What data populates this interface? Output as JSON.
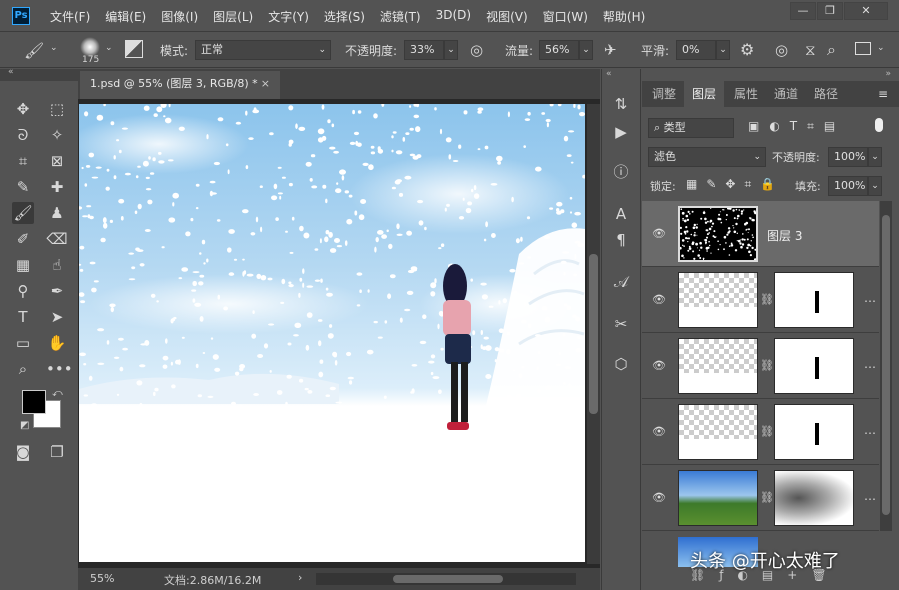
{
  "app": {
    "logo": "Ps"
  },
  "menu": [
    "文件(F)",
    "编辑(E)",
    "图像(I)",
    "图层(L)",
    "文字(Y)",
    "选择(S)",
    "滤镜(T)",
    "3D(D)",
    "视图(V)",
    "窗口(W)",
    "帮助(H)"
  ],
  "window_controls": {
    "minimize": "—",
    "restore": "❐",
    "close": "✕"
  },
  "options": {
    "brush_size": "175",
    "mode_label": "模式:",
    "mode_value": "正常",
    "opacity_label": "不透明度:",
    "opacity_value": "33%",
    "flow_label": "流量:",
    "flow_value": "56%",
    "smooth_label": "平滑:",
    "smooth_value": "0%"
  },
  "document": {
    "tab_title": "1.psd @ 55% (图层 3, RGB/8) *",
    "tab_close": "×",
    "zoom": "55%",
    "doc_info": "文档:2.86M/16.2M"
  },
  "panel_tabs": [
    "调整",
    "图层",
    "属性",
    "通道",
    "路径"
  ],
  "layers_panel": {
    "filter_kind": "类型",
    "blend_mode": "滤色",
    "opacity_label": "不透明度:",
    "opacity_value": "100%",
    "lock_label": "锁定:",
    "fill_label": "填充:",
    "fill_value": "100%",
    "layers": [
      {
        "name": "图层 3"
      },
      {
        "name": ""
      },
      {
        "name": ""
      },
      {
        "name": ""
      },
      {
        "name": ""
      }
    ]
  },
  "watermark": "头条 @开心太难了",
  "colors": {
    "accent": "#31a8ff",
    "bg": "#535353",
    "dark": "#424242"
  }
}
